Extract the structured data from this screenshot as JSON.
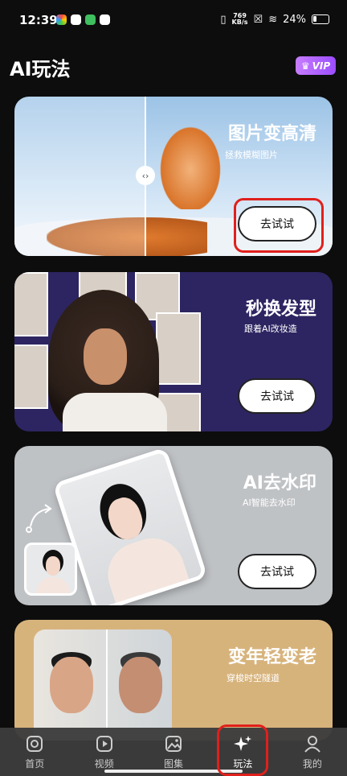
{
  "status_bar": {
    "time": "12:39",
    "speed_value": "769",
    "speed_unit": "KB/s",
    "battery": "24%"
  },
  "page": {
    "title": "AI玩法",
    "vip_label": "VIP"
  },
  "cards": [
    {
      "title": "图片变高清",
      "subtitle": "拯救模糊图片",
      "button": "去试试"
    },
    {
      "title": "秒换发型",
      "subtitle": "跟着AI改妆造",
      "button": "去试试"
    },
    {
      "title": "AI去水印",
      "subtitle": "AI智能去水印",
      "button": "去试试"
    },
    {
      "title": "变年轻变老",
      "subtitle": "穿梭时空隧道"
    }
  ],
  "nav": [
    {
      "label": "首页",
      "icon": "instagram-icon"
    },
    {
      "label": "视频",
      "icon": "play-icon"
    },
    {
      "label": "图集",
      "icon": "gallery-icon"
    },
    {
      "label": "玩法",
      "icon": "sparkle-icon",
      "active": true
    },
    {
      "label": "我的",
      "icon": "user-icon"
    }
  ],
  "colors": {
    "accent_vip": "#9b4dff",
    "highlight_red": "#e0201c"
  }
}
